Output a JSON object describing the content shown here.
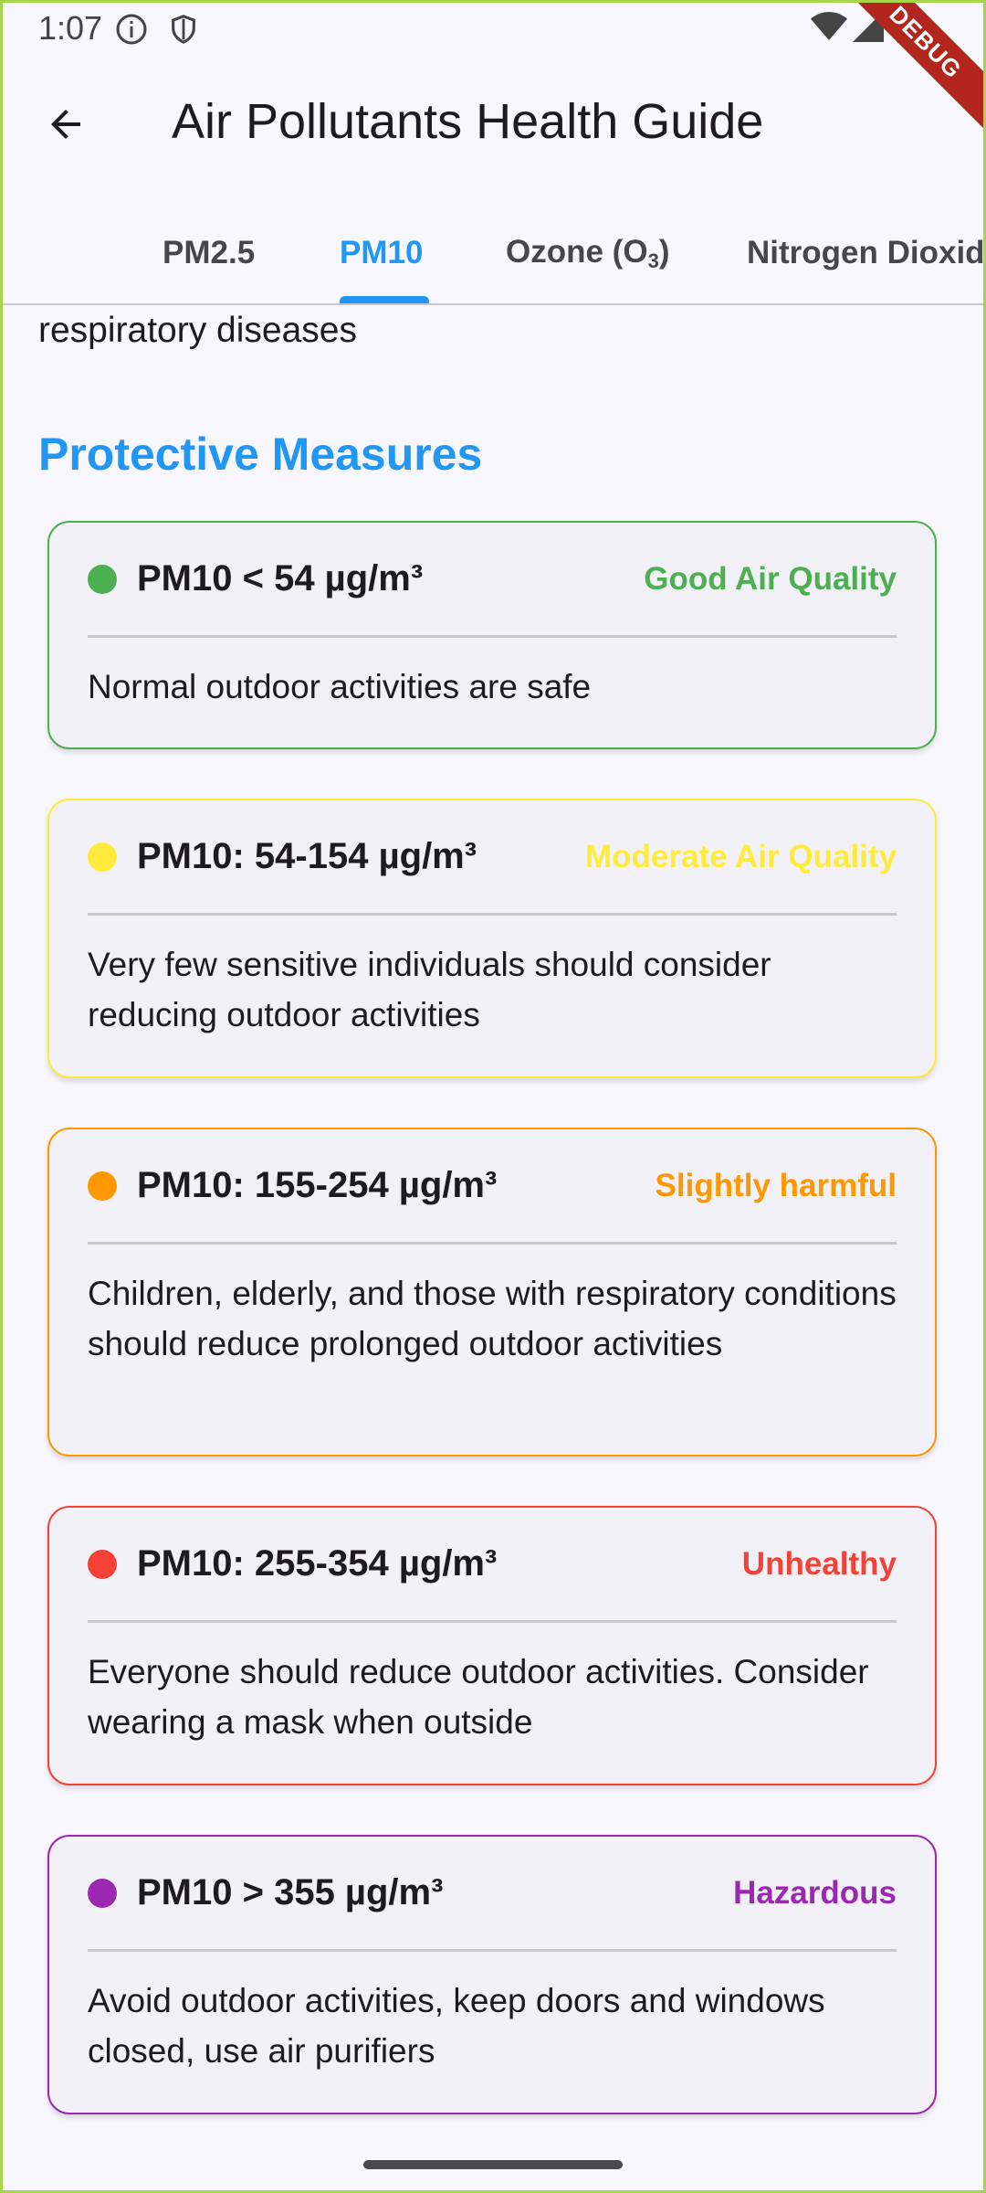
{
  "status_bar": {
    "time": "1:07",
    "icons": [
      "info-circle-icon",
      "shield-icon",
      "wifi-icon",
      "signal-icon",
      "battery-icon"
    ],
    "debug_banner": "DEBUG"
  },
  "app_bar": {
    "back_icon": "arrow-left-icon",
    "title": "Air Pollutants Health Guide"
  },
  "tabs": [
    {
      "label": "PM2.5",
      "active": false
    },
    {
      "label": "PM10",
      "active": true
    },
    {
      "label_main": "Ozone (O",
      "label_sub": "3",
      "label_end": ")",
      "active": false
    },
    {
      "label": "Nitrogen Dioxide",
      "active": false
    }
  ],
  "content": {
    "intro_tail": "respiratory diseases",
    "section_title": "Protective Measures",
    "levels": [
      {
        "range": "PM10 < 54 µg/m³",
        "label": "Good Air Quality",
        "advice": "Normal outdoor activities are safe",
        "color": "#4caf50"
      },
      {
        "range": "PM10: 54-154 µg/m³",
        "label": "Moderate Air Quality",
        "advice": "Very few sensitive individuals should consider reducing outdoor activities",
        "color": "#ffeb3b"
      },
      {
        "range": "PM10: 155-254 µg/m³",
        "label": "Slightly harmful",
        "advice": "Children, elderly, and those with respiratory conditions should reduce prolonged outdoor activities",
        "color": "#ff9800"
      },
      {
        "range": "PM10: 255-354 µg/m³",
        "label": "Unhealthy",
        "advice": "Everyone should reduce outdoor activities. Consider wearing a mask when outside",
        "color": "#f44336"
      },
      {
        "range": "PM10 > 355 µg/m³",
        "label": "Hazardous",
        "advice": "Avoid outdoor activities, keep doors and windows closed, use air purifiers",
        "color": "#9c27b0"
      }
    ]
  },
  "colors": {
    "accent": "#2196f3",
    "background": "#f7f7fd",
    "card_background": "#f2f1f8"
  }
}
